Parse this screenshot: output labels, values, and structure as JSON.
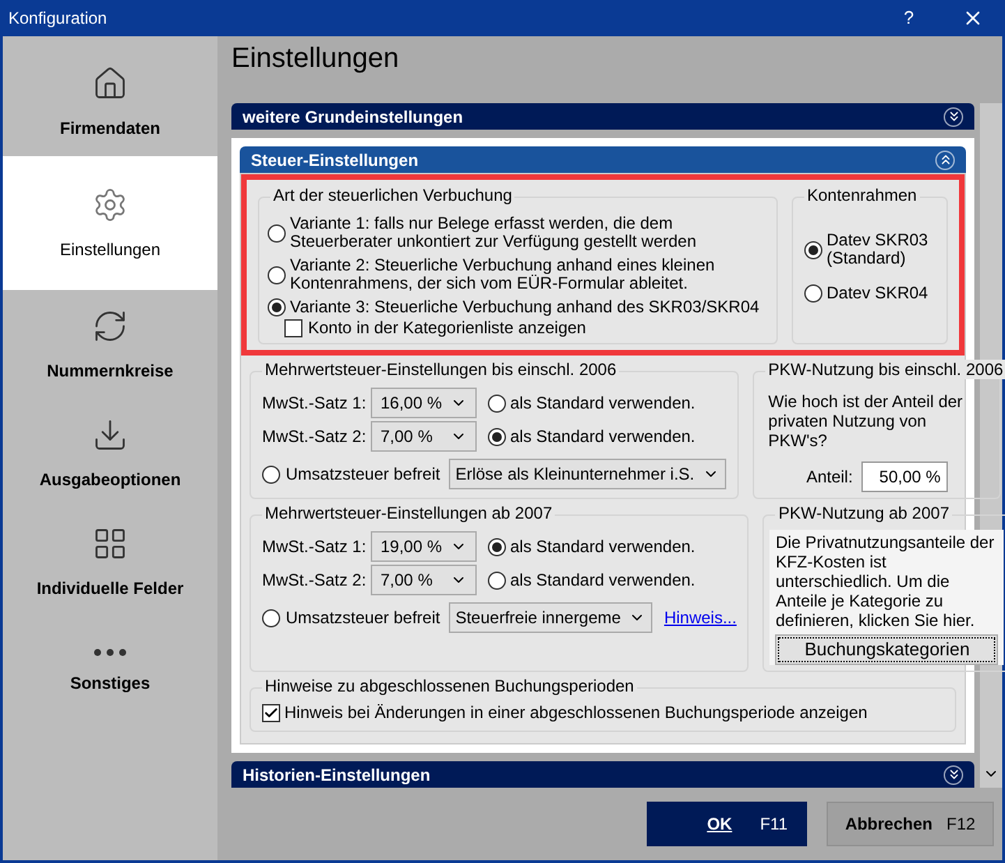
{
  "window": {
    "title": "Konfiguration",
    "help": "?"
  },
  "sidebar": {
    "items": [
      {
        "label": "Firmendaten",
        "selected": false
      },
      {
        "label": "Einstellungen",
        "selected": true
      },
      {
        "label": "Nummernkreise",
        "selected": false
      },
      {
        "label": "Ausgabeoptionen",
        "selected": false
      },
      {
        "label": "Individuelle Felder",
        "selected": false
      },
      {
        "label": "Sonstiges",
        "selected": false
      }
    ]
  },
  "heading": "Einstellungen",
  "sections_top": [
    {
      "title": "weitere Grundeinstellungen",
      "expanded": false
    }
  ],
  "steuer": {
    "title": "Steuer-Einstellungen",
    "expanded": true,
    "verbuchung": {
      "legend": "Art der steuerlichen Verbuchung",
      "options": [
        {
          "label": "Variante 1: falls nur Belege erfasst werden, die dem Steuerberater unkontiert zur Verfügung gestellt werden",
          "selected": false
        },
        {
          "label": "Variante 2: Steuerliche Verbuchung anhand eines kleinen Kontenrahmens, der sich vom EÜR-Formular ableitet.",
          "selected": false
        },
        {
          "label": "Variante 3: Steuerliche Verbuchung anhand des SKR03/SKR04",
          "selected": true
        }
      ],
      "checkbox": {
        "label": "Konto in der Kategorienliste anzeigen",
        "checked": false
      }
    },
    "kontenrahmen": {
      "legend": "Kontenrahmen",
      "options": [
        {
          "label": "Datev SKR03 (Standard)",
          "selected": true
        },
        {
          "label": "Datev SKR04",
          "selected": false
        }
      ]
    },
    "mwst_groups": [
      {
        "legend": "Mehrwertsteuer-Einstellungen bis einschl. 2006",
        "rates": [
          {
            "label": "MwSt.-Satz 1:",
            "value": "16,00 %",
            "standard_label": "als Standard verwenden.",
            "selected": false
          },
          {
            "label": "MwSt.-Satz 2:",
            "value": "7,00 %",
            "standard_label": "als Standard verwenden.",
            "selected": true
          }
        ],
        "exempt": {
          "label": "Umsatzsteuer befreit",
          "selected": false,
          "value": "Erlöse als Kleinunternehmer i.S."
        }
      },
      {
        "legend": "Mehrwertsteuer-Einstellungen ab 2007",
        "rates": [
          {
            "label": "MwSt.-Satz 1:",
            "value": "19,00 %",
            "standard_label": "als Standard verwenden.",
            "selected": true
          },
          {
            "label": "MwSt.-Satz 2:",
            "value": "7,00 %",
            "standard_label": "als Standard verwenden.",
            "selected": false
          }
        ],
        "exempt": {
          "label": "Umsatzsteuer befreit",
          "selected": false,
          "value": "Steuerfreie innergeme",
          "link": "Hinweis..."
        }
      }
    ],
    "pkw_2006": {
      "legend": "PKW-Nutzung bis einschl. 2006",
      "question": "Wie hoch ist der Anteil der privaten Nutzung von PKW's?",
      "field_label": "Anteil:",
      "value": "50,00 %"
    },
    "pkw_2007": {
      "legend": "PKW-Nutzung ab 2007",
      "text": "Die Privatnutzungsanteile der KFZ-Kosten ist unterschiedlich. Um die Anteile je Kategorie zu definieren, klicken Sie hier.",
      "button": "Buchungskategorien"
    },
    "hinweise": {
      "legend": "Hinweise zu abgeschlossenen Buchungsperioden",
      "checkbox": {
        "label": "Hinweis bei Änderungen in einer abgeschlossenen Buchungsperiode anzeigen",
        "checked": true
      }
    }
  },
  "sections_bottom": [
    {
      "title": "Historien-Einstellungen",
      "expanded": false
    }
  ],
  "footer": {
    "ok": {
      "label": "OK",
      "key": "F11"
    },
    "cancel": {
      "label": "Abbrechen",
      "key": "F12"
    }
  }
}
